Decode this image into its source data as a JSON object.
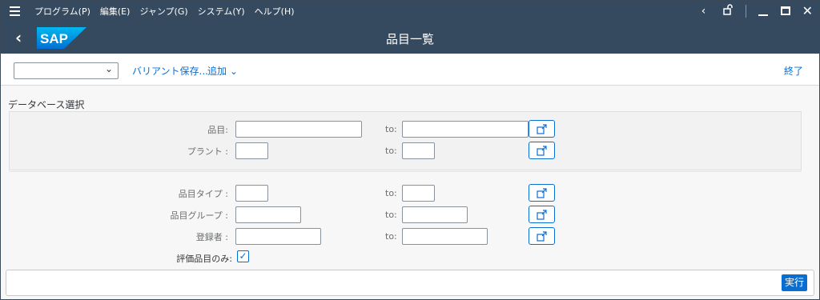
{
  "menubar": {
    "items": [
      "プログラム(P)",
      "編集(E)",
      "ジャンプ(G)",
      "システム(Y)",
      "ヘルプ(H)"
    ]
  },
  "shell": {
    "title": "品目一覧",
    "logo": "SAP"
  },
  "toolbar": {
    "variant_value": "",
    "save_variant": "バリアント保存...",
    "add": "追加",
    "exit": "終了"
  },
  "selection": {
    "group_title": "データベース選択",
    "to_label": "to:",
    "fields": [
      {
        "label": "品目:",
        "from": "",
        "to": ""
      },
      {
        "label": "プラント :",
        "from": "",
        "to": ""
      },
      {
        "label": "品目タイプ :",
        "from": "",
        "to": ""
      },
      {
        "label": "品目グループ :",
        "from": "",
        "to": ""
      },
      {
        "label": "登録者 :",
        "from": "",
        "to": ""
      }
    ],
    "valuated_only": {
      "label": "評価品目のみ:",
      "checked": true
    }
  },
  "footer": {
    "execute": "実行"
  },
  "colors": {
    "shell": "#354a5f",
    "accent": "#0a6ed1"
  }
}
